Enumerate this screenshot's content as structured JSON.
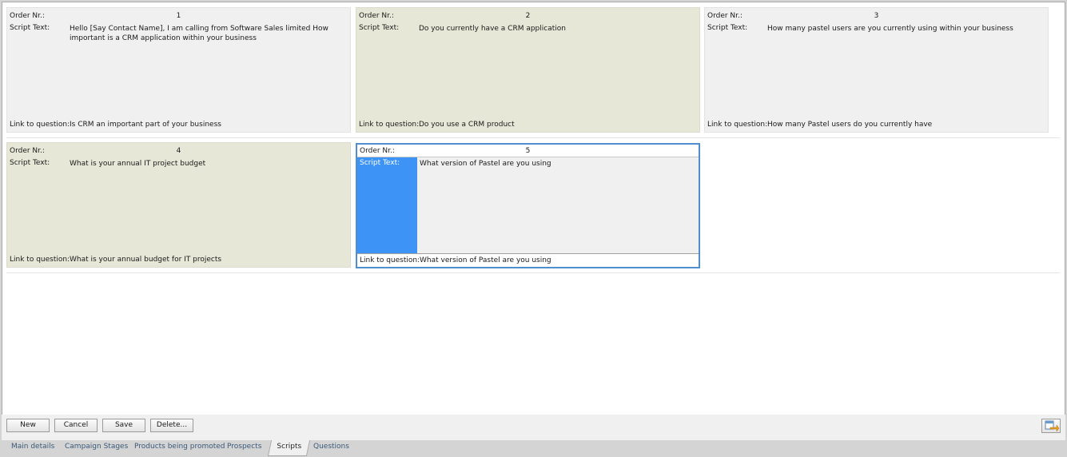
{
  "cards": [
    {
      "order_label": "Order Nr.:",
      "order": "1",
      "script_label": "Script Text:",
      "script": "Hello [Say Contact Name], I am calling from Software Sales limited  How important is a CRM application within your business",
      "link_label": "Link to question:",
      "link": "Is CRM an important part of your business"
    },
    {
      "order_label": "Order Nr.:",
      "order": "2",
      "script_label": "Script Text:",
      "script": "Do you currently have a CRM application",
      "link_label": "Link to question:",
      "link": "Do you use a CRM product"
    },
    {
      "order_label": "Order Nr.:",
      "order": "3",
      "script_label": "Script Text:",
      "script": "How many pastel users are you currently using within your business",
      "link_label": "Link to question:",
      "link": "How many Pastel users do you currently have"
    },
    {
      "order_label": "Order Nr.:",
      "order": "4",
      "script_label": "Script Text:",
      "script": "What is your annual IT project budget",
      "link_label": "Link to question:",
      "link": "What is your annual budget for IT projects"
    },
    {
      "order_label": "Order Nr.:",
      "order": "5",
      "script_label": "Script Text:",
      "script": "What version of Pastel are you using",
      "link_label": "Link to question:",
      "link": "What version of Pastel are you using"
    }
  ],
  "toolbar": {
    "new": "New",
    "cancel": "Cancel",
    "save": "Save",
    "delete": "Delete..."
  },
  "corner_icon": "export-icon",
  "tabs": [
    "Main details",
    "Campaign Stages",
    "Products being promoted",
    "Prospects",
    "Scripts",
    "Questions"
  ],
  "active_tab": "Scripts",
  "colors": {
    "card": "#f0f0f0",
    "card_alt": "#e6e7d7",
    "selection": "#3d94f6",
    "selected_border": "#4f8fd0"
  }
}
